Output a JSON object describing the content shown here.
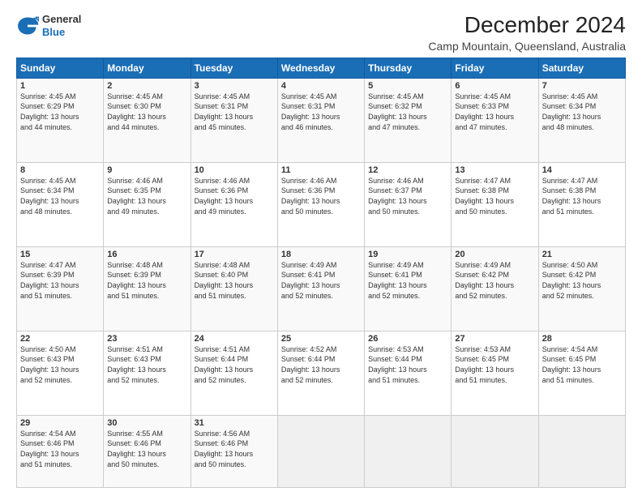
{
  "header": {
    "logo": {
      "general": "General",
      "blue": "Blue"
    },
    "title": "December 2024",
    "subtitle": "Camp Mountain, Queensland, Australia"
  },
  "calendar": {
    "days_of_week": [
      "Sunday",
      "Monday",
      "Tuesday",
      "Wednesday",
      "Thursday",
      "Friday",
      "Saturday"
    ],
    "weeks": [
      [
        {
          "day": "1",
          "sunrise": "4:45 AM",
          "sunset": "6:29 PM",
          "daylight": "13 hours and 44 minutes."
        },
        {
          "day": "2",
          "sunrise": "4:45 AM",
          "sunset": "6:30 PM",
          "daylight": "13 hours and 44 minutes."
        },
        {
          "day": "3",
          "sunrise": "4:45 AM",
          "sunset": "6:31 PM",
          "daylight": "13 hours and 45 minutes."
        },
        {
          "day": "4",
          "sunrise": "4:45 AM",
          "sunset": "6:31 PM",
          "daylight": "13 hours and 46 minutes."
        },
        {
          "day": "5",
          "sunrise": "4:45 AM",
          "sunset": "6:32 PM",
          "daylight": "13 hours and 47 minutes."
        },
        {
          "day": "6",
          "sunrise": "4:45 AM",
          "sunset": "6:33 PM",
          "daylight": "13 hours and 47 minutes."
        },
        {
          "day": "7",
          "sunrise": "4:45 AM",
          "sunset": "6:34 PM",
          "daylight": "13 hours and 48 minutes."
        }
      ],
      [
        {
          "day": "8",
          "sunrise": "4:45 AM",
          "sunset": "6:34 PM",
          "daylight": "13 hours and 48 minutes."
        },
        {
          "day": "9",
          "sunrise": "4:46 AM",
          "sunset": "6:35 PM",
          "daylight": "13 hours and 49 minutes."
        },
        {
          "day": "10",
          "sunrise": "4:46 AM",
          "sunset": "6:36 PM",
          "daylight": "13 hours and 49 minutes."
        },
        {
          "day": "11",
          "sunrise": "4:46 AM",
          "sunset": "6:36 PM",
          "daylight": "13 hours and 50 minutes."
        },
        {
          "day": "12",
          "sunrise": "4:46 AM",
          "sunset": "6:37 PM",
          "daylight": "13 hours and 50 minutes."
        },
        {
          "day": "13",
          "sunrise": "4:47 AM",
          "sunset": "6:38 PM",
          "daylight": "13 hours and 50 minutes."
        },
        {
          "day": "14",
          "sunrise": "4:47 AM",
          "sunset": "6:38 PM",
          "daylight": "13 hours and 51 minutes."
        }
      ],
      [
        {
          "day": "15",
          "sunrise": "4:47 AM",
          "sunset": "6:39 PM",
          "daylight": "13 hours and 51 minutes."
        },
        {
          "day": "16",
          "sunrise": "4:48 AM",
          "sunset": "6:39 PM",
          "daylight": "13 hours and 51 minutes."
        },
        {
          "day": "17",
          "sunrise": "4:48 AM",
          "sunset": "6:40 PM",
          "daylight": "13 hours and 51 minutes."
        },
        {
          "day": "18",
          "sunrise": "4:49 AM",
          "sunset": "6:41 PM",
          "daylight": "13 hours and 52 minutes."
        },
        {
          "day": "19",
          "sunrise": "4:49 AM",
          "sunset": "6:41 PM",
          "daylight": "13 hours and 52 minutes."
        },
        {
          "day": "20",
          "sunrise": "4:49 AM",
          "sunset": "6:42 PM",
          "daylight": "13 hours and 52 minutes."
        },
        {
          "day": "21",
          "sunrise": "4:50 AM",
          "sunset": "6:42 PM",
          "daylight": "13 hours and 52 minutes."
        }
      ],
      [
        {
          "day": "22",
          "sunrise": "4:50 AM",
          "sunset": "6:43 PM",
          "daylight": "13 hours and 52 minutes."
        },
        {
          "day": "23",
          "sunrise": "4:51 AM",
          "sunset": "6:43 PM",
          "daylight": "13 hours and 52 minutes."
        },
        {
          "day": "24",
          "sunrise": "4:51 AM",
          "sunset": "6:44 PM",
          "daylight": "13 hours and 52 minutes."
        },
        {
          "day": "25",
          "sunrise": "4:52 AM",
          "sunset": "6:44 PM",
          "daylight": "13 hours and 52 minutes."
        },
        {
          "day": "26",
          "sunrise": "4:53 AM",
          "sunset": "6:44 PM",
          "daylight": "13 hours and 51 minutes."
        },
        {
          "day": "27",
          "sunrise": "4:53 AM",
          "sunset": "6:45 PM",
          "daylight": "13 hours and 51 minutes."
        },
        {
          "day": "28",
          "sunrise": "4:54 AM",
          "sunset": "6:45 PM",
          "daylight": "13 hours and 51 minutes."
        }
      ],
      [
        {
          "day": "29",
          "sunrise": "4:54 AM",
          "sunset": "6:46 PM",
          "daylight": "13 hours and 51 minutes."
        },
        {
          "day": "30",
          "sunrise": "4:55 AM",
          "sunset": "6:46 PM",
          "daylight": "13 hours and 50 minutes."
        },
        {
          "day": "31",
          "sunrise": "4:56 AM",
          "sunset": "6:46 PM",
          "daylight": "13 hours and 50 minutes."
        },
        null,
        null,
        null,
        null
      ]
    ]
  }
}
